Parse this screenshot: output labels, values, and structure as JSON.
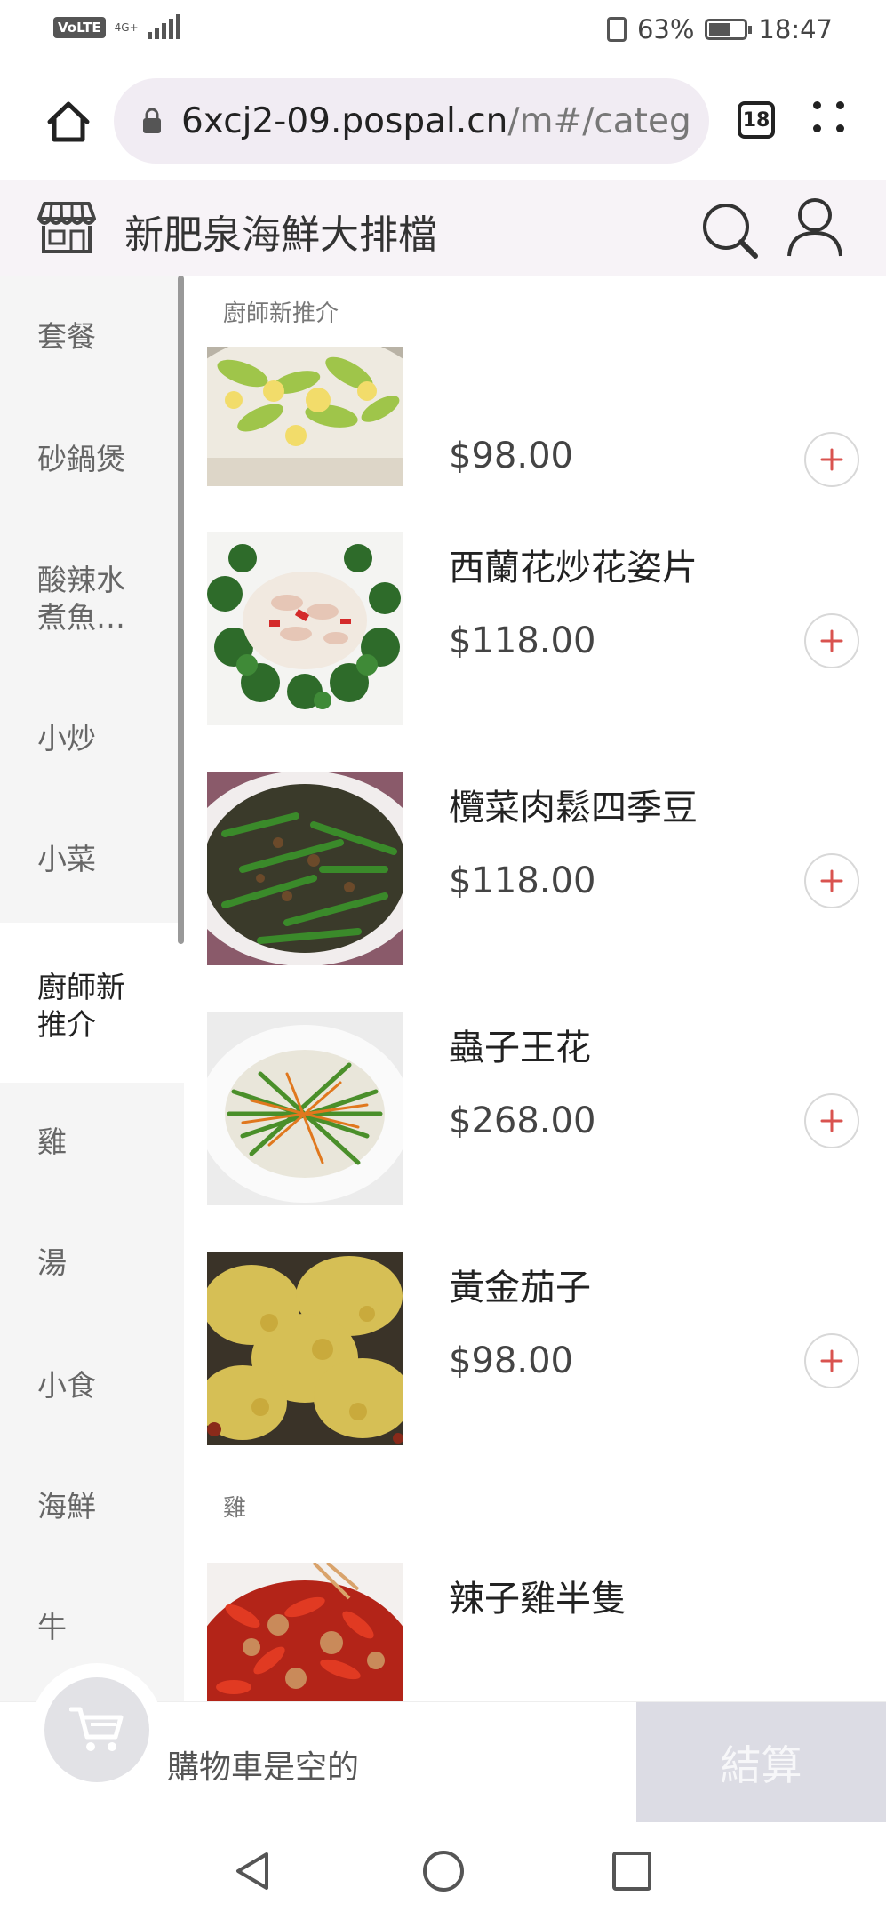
{
  "status_bar": {
    "volte": "VoLTE",
    "network": "4G+",
    "battery_percent": "63%",
    "battery_level": 0.63,
    "time": "18:47"
  },
  "browser": {
    "url_main": "6xcj2-09.pospal.cn",
    "url_rest": "/m#/categ",
    "tab_count": "18"
  },
  "store": {
    "name": "新肥泉海鮮大排檔"
  },
  "sidebar": {
    "items": [
      {
        "label": "套餐"
      },
      {
        "label": "砂鍋煲"
      },
      {
        "label": "酸辣水煮魚…"
      },
      {
        "label": "小炒"
      },
      {
        "label": "小菜"
      },
      {
        "label": "廚師新推介",
        "active": true
      },
      {
        "label": "雞"
      },
      {
        "label": "湯"
      },
      {
        "label": "小食"
      },
      {
        "label": "海鮮"
      },
      {
        "label": "牛"
      }
    ]
  },
  "sections": [
    {
      "title": "廚師新推介",
      "products": [
        {
          "name": "",
          "price": "$98.00",
          "image": "stir-fried-vegetables"
        },
        {
          "name": "西蘭花炒花姿片",
          "price": "$118.00",
          "image": "broccoli-squid"
        },
        {
          "name": "欖菜肉鬆四季豆",
          "price": "$118.00",
          "image": "green-beans"
        },
        {
          "name": "蟲子王花",
          "price": "$268.00",
          "image": "bean-carrot-shreds"
        },
        {
          "name": "黃金茄子",
          "price": "$98.00",
          "image": "golden-eggplant"
        }
      ]
    },
    {
      "title": "雞",
      "products": [
        {
          "name": "辣子雞半隻",
          "price": "",
          "image": "spicy-chicken"
        }
      ]
    }
  ],
  "cart": {
    "empty_text": "購物車是空的",
    "checkout_label": "結算"
  },
  "colors": {
    "accent": "#d9534f",
    "sidebar_bg": "#f5f5f5",
    "header_bg": "#f7f3f7",
    "checkout_bg": "#dcdce4"
  }
}
